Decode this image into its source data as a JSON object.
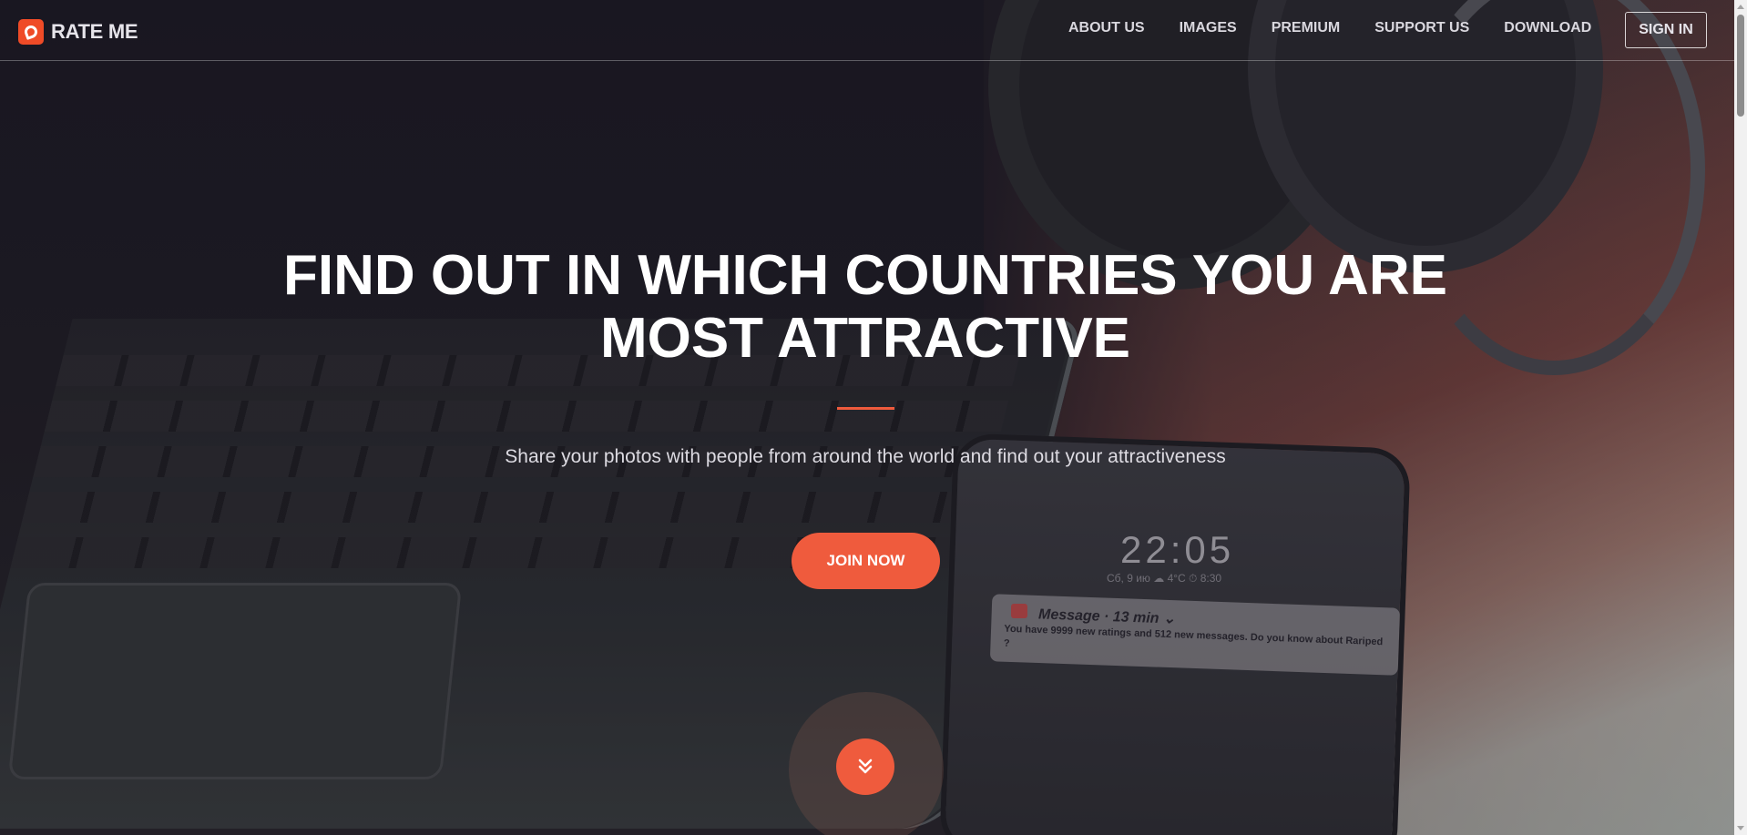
{
  "brand": {
    "name": "RATE ME",
    "logo_icon": "flame-icon",
    "accent": "#ef4b27"
  },
  "nav": {
    "items": [
      {
        "label": "ABOUT US"
      },
      {
        "label": "IMAGES"
      },
      {
        "label": "PREMIUM"
      },
      {
        "label": "SUPPORT US"
      },
      {
        "label": "DOWNLOAD"
      }
    ],
    "signin_label": "SIGN IN"
  },
  "hero": {
    "title_line1": "FIND OUT IN WHICH COUNTRIES YOU ARE",
    "title_line2": "MOST ATTRACTIVE",
    "subtitle": "Share your photos with people from around the world and find out your attractiveness",
    "cta_label": "JOIN NOW",
    "scroll_icon": "double-chevron-down-icon",
    "accent": "#ef5b3d"
  },
  "background_phone": {
    "clock": "22:05",
    "status": "Сб, 9 ию  ☁  4°C  ⏱  8:30",
    "notification_title": "Message · 13 min ⌄",
    "notification_body": "You have 9999 new ratings and 512 new messages. Do you know about Rariped ?"
  }
}
